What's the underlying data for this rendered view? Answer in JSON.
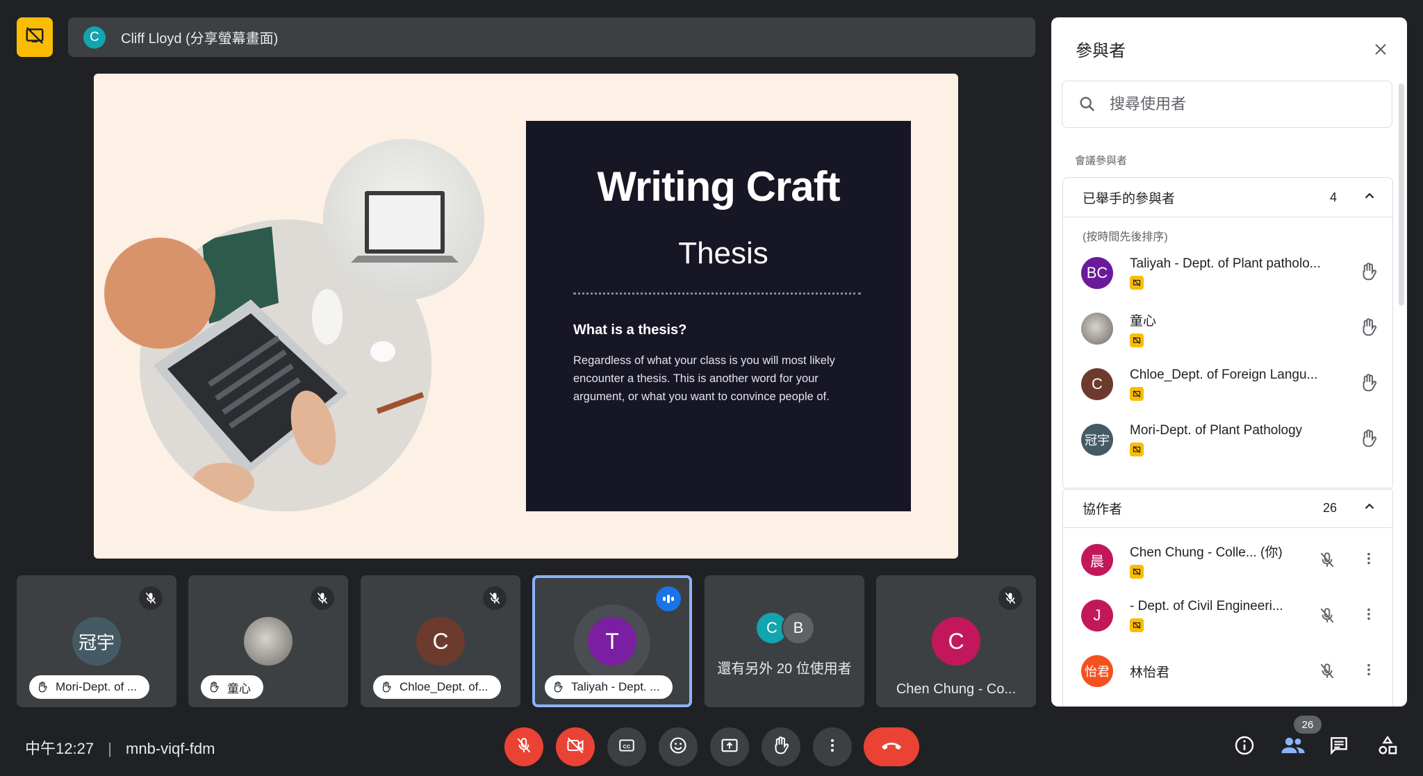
{
  "topbar": {
    "presenter_initial": "C",
    "presenter_label": "Cliff Lloyd (分享螢幕畫面)"
  },
  "slide": {
    "title": "Writing Craft",
    "subtitle": "Thesis",
    "heading": "What is a thesis?",
    "body": "Regardless of what your class is you will most likely encounter a thesis. This is another word for your argument, or what you want to convince people of."
  },
  "tiles": [
    {
      "avatar": "冠宇",
      "label": "Mori-Dept. of ..."
    },
    {
      "avatar": "",
      "label": "童心"
    },
    {
      "avatar": "C",
      "label": "Chloe_Dept. of..."
    },
    {
      "avatar": "T",
      "label": "Taliyah - Dept. ..."
    },
    {
      "avatar1": "C",
      "avatar2": "B",
      "label": "還有另外 20 位使用者"
    },
    {
      "avatar": "C",
      "label": "Chen Chung - Co..."
    }
  ],
  "bottombar": {
    "time": "中午12:27",
    "separator": "|",
    "meeting_code": "mnb-viqf-fdm",
    "participant_count": "26"
  },
  "panel": {
    "title": "參與者",
    "search_placeholder": "搜尋使用者",
    "section_label": "會議參與者",
    "raised": {
      "title": "已舉手的參與者",
      "count": "4",
      "sort_note": "(按時間先後排序)",
      "people": [
        {
          "avatar": "BC",
          "name": "Taliyah - Dept. of Plant patholo..."
        },
        {
          "avatar": "",
          "name": "童心"
        },
        {
          "avatar": "C",
          "name": "Chloe_Dept. of Foreign Langu..."
        },
        {
          "avatar": "冠宇",
          "name": "Mori-Dept. of Plant Pathology"
        }
      ]
    },
    "collaborators": {
      "title": "協作者",
      "count": "26",
      "people": [
        {
          "avatar": "晨",
          "name": "Chen Chung - Colle...  (你)"
        },
        {
          "avatar": "J",
          "name": "- Dept. of Civil Engineeri..."
        },
        {
          "avatar": "怡君",
          "name": "林怡君"
        }
      ]
    }
  },
  "colors": {
    "background": "#202124",
    "tile": "#3c4043",
    "danger": "#ea4335",
    "accent": "#8ab4f8",
    "badge": "#fbbc04"
  },
  "icons": [
    "present-off-icon",
    "mic-off-icon",
    "video-off-icon",
    "captions-icon",
    "emoji-icon",
    "present-icon",
    "raise-hand-icon",
    "more-icon",
    "end-call-icon",
    "info-icon",
    "people-icon",
    "chat-icon",
    "activities-icon",
    "search-icon",
    "close-icon",
    "chevron-up-icon",
    "audio-active-icon"
  ]
}
